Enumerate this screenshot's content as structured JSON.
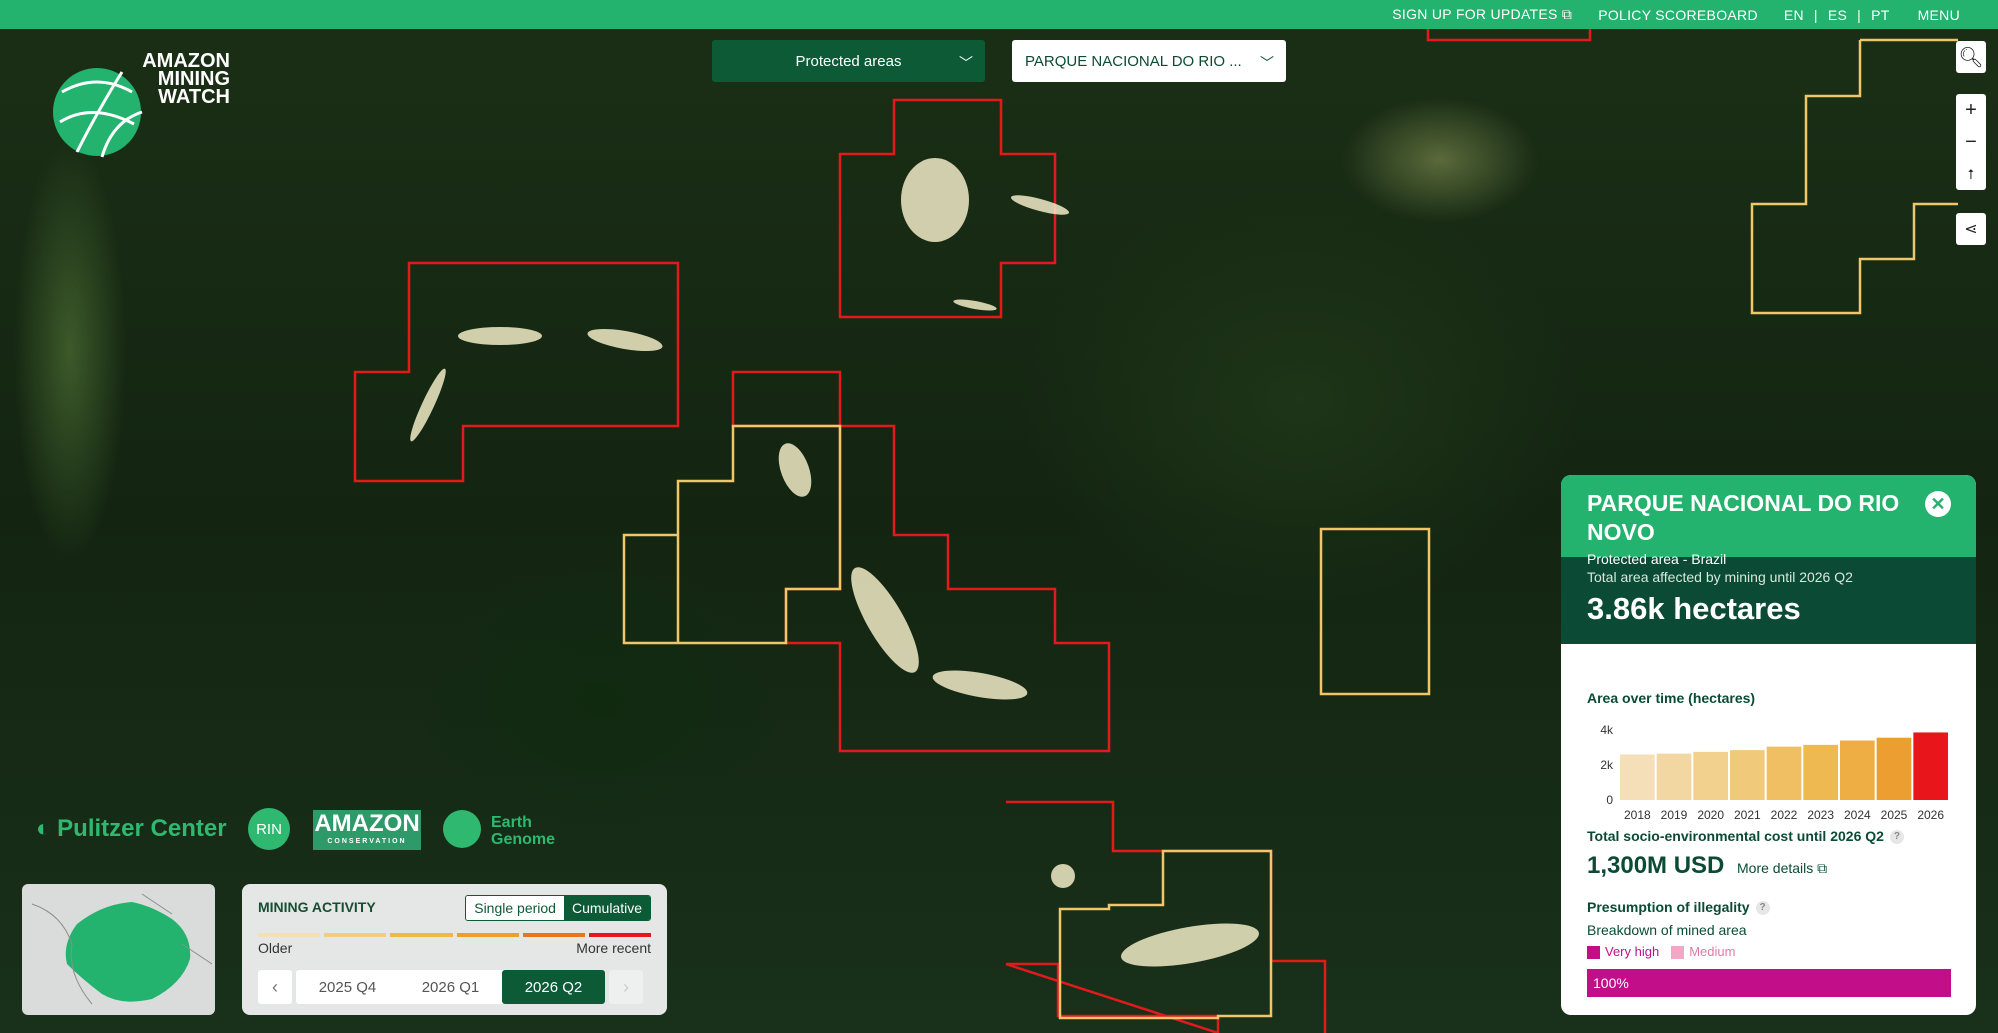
{
  "topbar": {
    "signup": "SIGN UP FOR UPDATES",
    "policy": "POLICY SCOREBOARD",
    "langs": [
      "EN",
      "|",
      "ES",
      "|",
      "PT"
    ],
    "menu": "MENU"
  },
  "logo": {
    "line1": "AMAZON",
    "line2": "MINING",
    "line3": "WATCH"
  },
  "filters": {
    "layer": "Protected areas",
    "area": "PARQUE NACIONAL DO RIO ..."
  },
  "partners": {
    "pulitzer": "Pulitzer Center",
    "rin": "RIN",
    "amazon": "AMAZON",
    "amazon_sub": "CONSERVATION",
    "earth1": "Earth",
    "earth2": "Genome"
  },
  "activity": {
    "title": "MINING ACTIVITY",
    "mode_single": "Single period",
    "mode_cumulative": "Cumulative",
    "older": "Older",
    "recent": "More recent",
    "periods": [
      "2025 Q4",
      "2026 Q1",
      "2026 Q2"
    ],
    "active_period": "2026 Q2",
    "bar_colors": [
      "#f4dfb8",
      "#f1cd7c",
      "#f0b84a",
      "#ee9e2f",
      "#e8761f",
      "#e8151a"
    ]
  },
  "panel": {
    "title": "PARQUE NACIONAL DO RIO NOVO",
    "subtitle": "Protected area - Brazil",
    "total_label": "Total area affected by mining until 2026 Q2",
    "total_value": "3.86k hectares",
    "area_title": "Area over time (hectares)",
    "cost_title": "Total socio-environmental cost until 2026 Q2",
    "cost_value": "1,300M USD",
    "more_details": "More details",
    "illegality_title": "Presumption of illegality",
    "breakdown": "Breakdown of mined area",
    "legend_high": "Very high",
    "legend_medium": "Medium",
    "illegality_value": "100%",
    "colors": {
      "very_high": "#c30e8a",
      "medium": "#f4a6c6"
    }
  },
  "chart_data": {
    "type": "bar",
    "title": "Area over time (hectares)",
    "categories": [
      "2018",
      "2019",
      "2020",
      "2021",
      "2022",
      "2023",
      "2024",
      "2025",
      "2026"
    ],
    "ylim": [
      0,
      4000
    ],
    "yticks": [
      "4k",
      "2k",
      "0"
    ],
    "values": [
      2600,
      2650,
      2750,
      2850,
      3050,
      3150,
      3400,
      3560,
      3860
    ]
  }
}
